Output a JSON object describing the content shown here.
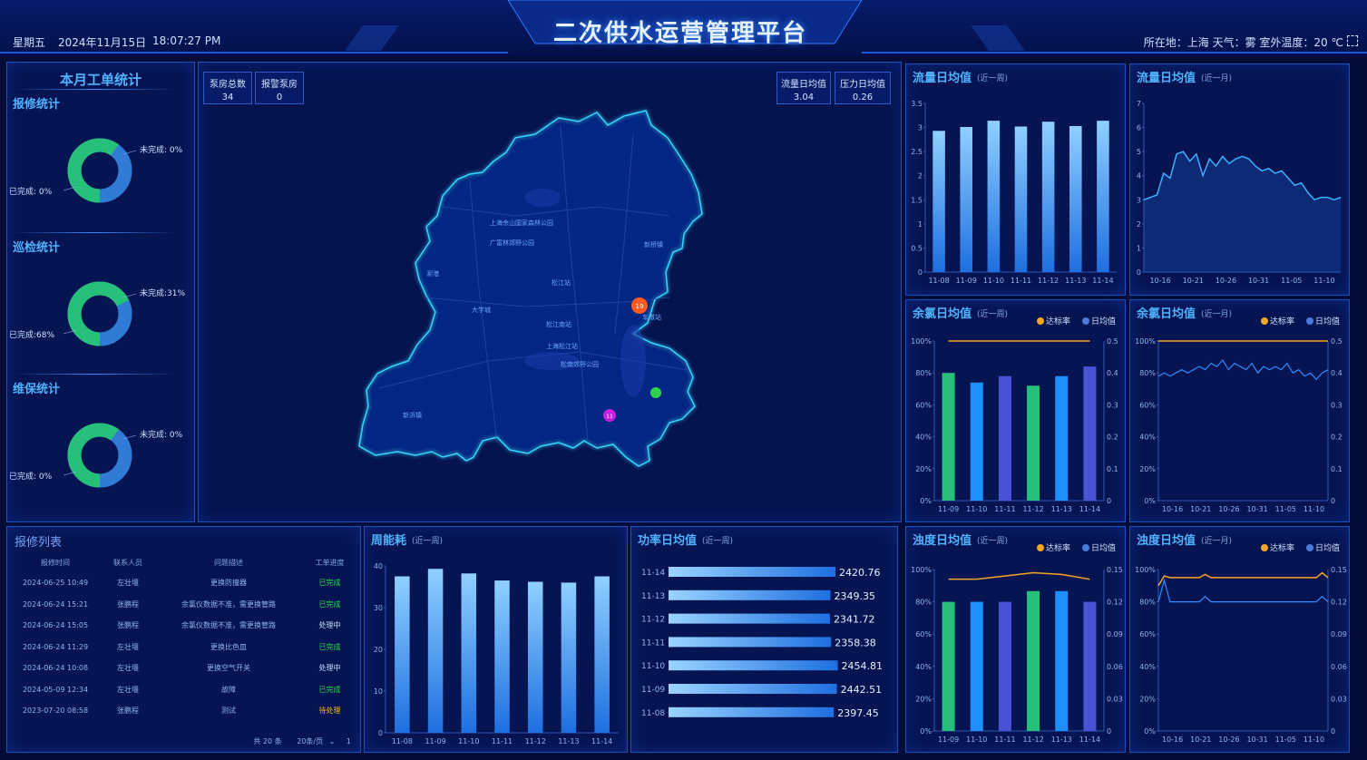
{
  "header": {
    "weekday": "星期五",
    "date": "2024年11月15日",
    "time": "18:07:27 PM",
    "title": "二次供水运营管理平台",
    "location_info": "所在地：上海 天气：雾 室外温度：20 ℃"
  },
  "workorder": {
    "title": "本月工单统计",
    "sections": [
      {
        "title": "报修统计",
        "unfinished": "未完成: 0%",
        "finished": "已完成: 0%",
        "done_fraction": 0.6
      },
      {
        "title": "巡检统计",
        "unfinished": "未完成:31%",
        "finished": "已完成:68%",
        "done_fraction": 0.68
      },
      {
        "title": "维保统计",
        "unfinished": "未完成: 0%",
        "finished": "已完成: 0%",
        "done_fraction": 0.6
      }
    ]
  },
  "map": {
    "stats_left": [
      {
        "label": "泵房总数",
        "value": "34"
      },
      {
        "label": "报警泵房",
        "value": "0"
      }
    ],
    "stats_right": [
      {
        "label": "流量日均值",
        "value": "3.04"
      },
      {
        "label": "压力日均值",
        "value": "0.26"
      }
    ],
    "labels": [
      "上海佘山国家森林公园",
      "广富林郊野公园",
      "新桥镇",
      "松江站",
      "大学城",
      "松江南站",
      "上海松江站",
      "松南郊野公园",
      "车墩站",
      "新浜镇",
      "泖港"
    ],
    "markers": [
      {
        "label": "19",
        "color": "#ff5a1f"
      },
      {
        "label": "",
        "color": "#2fd24a"
      },
      {
        "label": "11",
        "color": "#c81ee0"
      }
    ]
  },
  "repair_list": {
    "title": "报修列表",
    "columns": [
      "报修时间",
      "联系人员",
      "问题描述",
      "工单进度"
    ],
    "rows": [
      [
        "2024-06-25 10:49",
        "左壮堰",
        "更换防撞器",
        "已完成"
      ],
      [
        "2024-06-24 15:21",
        "张鹏程",
        "余氯仪数据不准，需更换管路",
        "已完成"
      ],
      [
        "2024-06-24 15:05",
        "张鹏程",
        "余氯仪数据不准，需更换管路",
        "处理中"
      ],
      [
        "2024-06-24 11:29",
        "左壮堰",
        "更换比色皿",
        "已完成"
      ],
      [
        "2024-06-24 10:08",
        "左壮堰",
        "更换空气开关",
        "处理中"
      ],
      [
        "2024-05-09 12:34",
        "左壮堰",
        "故障",
        "已完成"
      ],
      [
        "2023-07-20 08:58",
        "张鹏程",
        "测试",
        "待处理"
      ]
    ],
    "status_colors": {
      "已完成": "#2fd24a",
      "处理中": "#cfe0ff",
      "待处理": "#ffc21a"
    },
    "pagination": {
      "total": "共 20 条",
      "page_size": "20条/页",
      "page": "1"
    }
  },
  "colors": {
    "accent": "#4fb3ff",
    "bar": "#1e8fff",
    "green": "#27c07a",
    "purple": "#4a52d6",
    "orange": "#f5a623"
  },
  "chart_data": [
    {
      "id": "energy",
      "type": "bar",
      "title": "周能耗",
      "subtitle": "(近一周)",
      "categories": [
        "11-08",
        "11-09",
        "11-10",
        "11-11",
        "11-12",
        "11-13",
        "11-14"
      ],
      "values": [
        37.5,
        39.3,
        38.2,
        36.5,
        36.2,
        36,
        37.5
      ],
      "ylim": [
        0,
        40
      ],
      "yticks": [
        "0",
        "10",
        "20",
        "30",
        "40"
      ]
    },
    {
      "id": "power",
      "type": "bar",
      "orientation": "horizontal",
      "title": "功率日均值",
      "subtitle": "(近一周)",
      "categories": [
        "11-14",
        "11-13",
        "11-12",
        "11-11",
        "11-10",
        "11-09",
        "11-08"
      ],
      "values": [
        2420.76,
        2349.35,
        2341.72,
        2358.38,
        2454.81,
        2442.51,
        2397.45
      ],
      "value_labels": [
        "2420.76",
        "2349.35",
        "2341.72",
        "2358.38",
        "2454.81",
        "2442.51",
        "2397.45"
      ],
      "xlim": [
        0,
        2500
      ]
    },
    {
      "id": "flow_week",
      "type": "bar",
      "title": "流量日均值",
      "subtitle": "(近一周)",
      "categories": [
        "11-08",
        "11-09",
        "11-10",
        "11-11",
        "11-12",
        "11-13",
        "11-14"
      ],
      "values": [
        2.93,
        3.01,
        3.14,
        3.02,
        3.12,
        3.03,
        3.14
      ],
      "ylim": [
        0,
        3.5
      ],
      "yticks": [
        "0",
        "0.5",
        "1",
        "1.5",
        "2",
        "2.5",
        "3",
        "3.5"
      ]
    },
    {
      "id": "flow_month",
      "type": "line",
      "title": "流量日均值",
      "subtitle": "(近一月)",
      "categories": [
        "10-16",
        "10-21",
        "10-26",
        "10-31",
        "11-05",
        "11-10"
      ],
      "values": [
        3.0,
        3.1,
        3.2,
        4.1,
        3.9,
        4.9,
        5.0,
        4.6,
        4.9,
        4.0,
        4.7,
        4.4,
        4.8,
        4.5,
        4.7,
        4.8,
        4.7,
        4.4,
        4.2,
        4.3,
        4.1,
        4.2,
        3.9,
        3.6,
        3.7,
        3.3,
        3.0,
        3.1,
        3.1,
        3.0,
        3.1
      ],
      "ylim": [
        0,
        7
      ],
      "yticks": [
        "0",
        "1",
        "2",
        "3",
        "4",
        "5",
        "6",
        "7"
      ]
    },
    {
      "id": "chlorine_week",
      "type": "bar",
      "title": "余氯日均值",
      "subtitle": "(近一周)",
      "legend": [
        "达标率",
        "日均值"
      ],
      "categories": [
        "11-09",
        "11-10",
        "11-11",
        "11-12",
        "11-13",
        "11-14"
      ],
      "values": [
        0.4,
        0.37,
        0.39,
        0.36,
        0.39,
        0.42
      ],
      "bar_colors": [
        "#27c07a",
        "#1e8fff",
        "#4a52d6",
        "#27c07a",
        "#1e8fff",
        "#4a52d6"
      ],
      "rate": [
        100,
        100,
        100,
        100,
        100,
        100
      ],
      "ylim": [
        0,
        0.5
      ],
      "yticks_left": [
        "0%",
        "20%",
        "40%",
        "60%",
        "80%",
        "100%"
      ],
      "yticks_right": [
        "0",
        "0.1",
        "0.2",
        "0.3",
        "0.4",
        "0.5"
      ]
    },
    {
      "id": "chlorine_month",
      "type": "line",
      "title": "余氯日均值",
      "subtitle": "(近一月)",
      "legend": [
        "达标率",
        "日均值"
      ],
      "categories": [
        "10-16",
        "10-21",
        "10-26",
        "10-31",
        "11-05",
        "11-10"
      ],
      "rate": [
        100,
        100,
        100,
        100,
        100,
        100,
        100,
        100,
        100,
        100,
        100,
        100,
        100,
        100,
        100,
        100,
        100,
        100,
        100,
        100,
        100,
        100,
        100,
        100,
        100,
        100,
        100,
        100,
        100,
        100
      ],
      "values": [
        0.39,
        0.4,
        0.39,
        0.4,
        0.41,
        0.4,
        0.41,
        0.42,
        0.41,
        0.43,
        0.42,
        0.44,
        0.41,
        0.43,
        0.42,
        0.41,
        0.43,
        0.4,
        0.42,
        0.41,
        0.42,
        0.41,
        0.43,
        0.4,
        0.41,
        0.39,
        0.4,
        0.38,
        0.4,
        0.41
      ],
      "ylim": [
        0,
        0.5
      ],
      "yticks_left": [
        "0%",
        "20%",
        "40%",
        "60%",
        "80%",
        "100%"
      ],
      "yticks_right": [
        "0",
        "0.1",
        "0.2",
        "0.3",
        "0.4",
        "0.5"
      ]
    },
    {
      "id": "turbidity_week",
      "type": "bar",
      "title": "浊度日均值",
      "subtitle": "(近一周)",
      "legend": [
        "达标率",
        "日均值"
      ],
      "categories": [
        "11-09",
        "11-10",
        "11-11",
        "11-12",
        "11-13",
        "11-14"
      ],
      "values": [
        0.12,
        0.12,
        0.12,
        0.13,
        0.13,
        0.12
      ],
      "bar_colors": [
        "#27c07a",
        "#1e8fff",
        "#4a52d6",
        "#27c07a",
        "#1e8fff",
        "#4a52d6"
      ],
      "rate": [
        94,
        94,
        96,
        98,
        97,
        94
      ],
      "ylim": [
        0,
        0.15
      ],
      "yticks_left": [
        "0%",
        "20%",
        "40%",
        "60%",
        "80%",
        "100%"
      ],
      "yticks_right": [
        "0",
        "0.03",
        "0.06",
        "0.09",
        "0.12",
        "0.15"
      ]
    },
    {
      "id": "turbidity_month",
      "type": "line",
      "title": "浊度日均值",
      "subtitle": "(近一月)",
      "legend": [
        "达标率",
        "日均值"
      ],
      "categories": [
        "10-16",
        "10-21",
        "10-26",
        "10-31",
        "11-05",
        "11-10"
      ],
      "rate": [
        90,
        96,
        95,
        95,
        95,
        95,
        95,
        95,
        97,
        95,
        95,
        95,
        95,
        95,
        95,
        95,
        95,
        95,
        95,
        95,
        95,
        95,
        95,
        95,
        95,
        95,
        95,
        95,
        98,
        95
      ],
      "values": [
        0.12,
        0.14,
        0.12,
        0.12,
        0.12,
        0.12,
        0.12,
        0.12,
        0.125,
        0.12,
        0.12,
        0.12,
        0.12,
        0.12,
        0.12,
        0.12,
        0.12,
        0.12,
        0.12,
        0.12,
        0.12,
        0.12,
        0.12,
        0.12,
        0.12,
        0.12,
        0.12,
        0.12,
        0.125,
        0.12
      ],
      "ylim": [
        0,
        0.15
      ],
      "yticks_left": [
        "0%",
        "20%",
        "40%",
        "60%",
        "80%",
        "100%"
      ],
      "yticks_right": [
        "0",
        "0.03",
        "0.06",
        "0.09",
        "0.12",
        "0.15"
      ]
    }
  ]
}
